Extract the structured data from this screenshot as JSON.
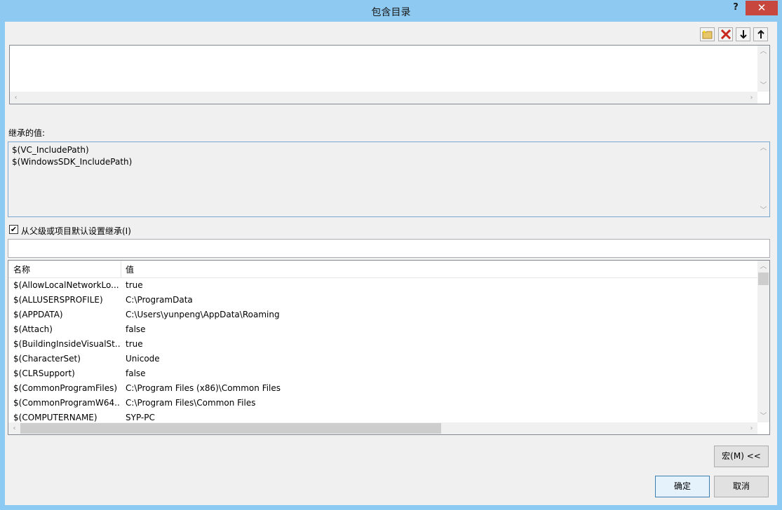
{
  "window": {
    "title": "包含目录",
    "help": "?",
    "close": "✕"
  },
  "toolbar": {
    "new_line": "new-folder-icon",
    "delete": "delete-icon",
    "move_down": "move-down-icon",
    "move_up": "move-up-icon"
  },
  "inherited": {
    "label": "继承的值:",
    "lines": [
      "$(VC_IncludePath)",
      "$(WindowsSDK_IncludePath)"
    ]
  },
  "inherit_checkbox": {
    "checked": true,
    "label": "从父级或项目默认设置继承(I)"
  },
  "filter": {
    "value": ""
  },
  "macros": {
    "headers": [
      "名称",
      "值"
    ],
    "rows": [
      {
        "name": "$(AllowLocalNetworkLo...",
        "value": "true"
      },
      {
        "name": "$(ALLUSERSPROFILE)",
        "value": "C:\\ProgramData"
      },
      {
        "name": "$(APPDATA)",
        "value": "C:\\Users\\yunpeng\\AppData\\Roaming"
      },
      {
        "name": "$(Attach)",
        "value": "false"
      },
      {
        "name": "$(BuildingInsideVisualSt...",
        "value": "true"
      },
      {
        "name": "$(CharacterSet)",
        "value": "Unicode"
      },
      {
        "name": "$(CLRSupport)",
        "value": "false"
      },
      {
        "name": "$(CommonProgramFiles)",
        "value": "C:\\Program Files (x86)\\Common Files"
      },
      {
        "name": "$(CommonProgramW64...",
        "value": "C:\\Program Files\\Common Files"
      },
      {
        "name": "$(COMPUTERNAME)",
        "value": "SYP-PC"
      }
    ]
  },
  "buttons": {
    "macros": "宏(M) <<",
    "ok": "确定",
    "cancel": "取消"
  }
}
